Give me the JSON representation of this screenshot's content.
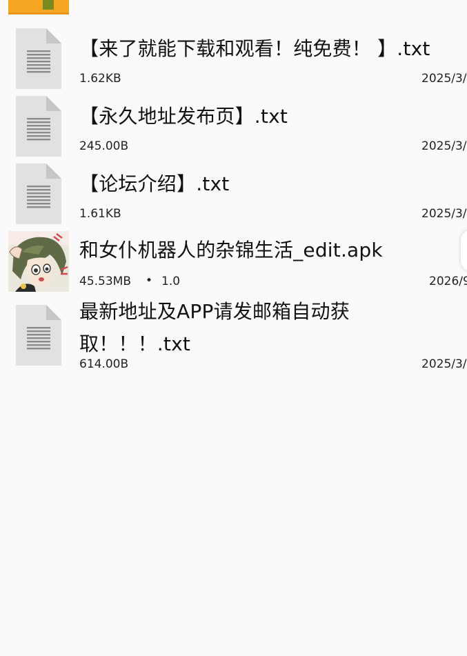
{
  "colors": {
    "background": "#fafafa",
    "folder": "#f5a623",
    "file_icon": "#e1e1e1",
    "file_fold": "#c6c6c6",
    "file_lines": "#8a8a8a"
  },
  "files": [
    {
      "name": "【来了就能下载和观看！纯免费！ 】.txt",
      "size": "1.62KB",
      "date": "2025/3/",
      "icon": "text-file-icon"
    },
    {
      "name": "【永久地址发布页】.txt",
      "size": "245.00B",
      "date": "2025/3/",
      "icon": "text-file-icon"
    },
    {
      "name": "【论坛介绍】.txt",
      "size": "1.61KB",
      "date": "2025/3/",
      "icon": "text-file-icon"
    },
    {
      "name": "和女仆机器人的杂锦生活_edit.apk",
      "size": "45.53MB",
      "separator": "•",
      "version": "1.0",
      "date": "2026/9",
      "icon": "apk-app-icon"
    },
    {
      "name": "最新地址及APP请发邮箱自动获取！！！.txt",
      "size": "614.00B",
      "date": "2025/3/",
      "icon": "text-file-icon"
    }
  ]
}
